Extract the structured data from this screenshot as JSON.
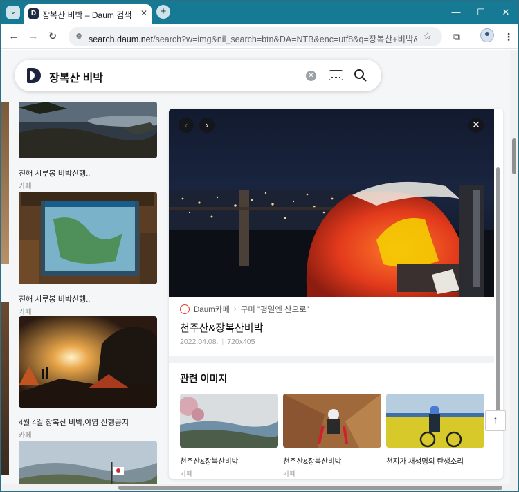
{
  "browser": {
    "tab_title": "장복산 비박 – Daum 검색",
    "tab_favicon": "D",
    "url_host": "search.daum.net",
    "url_path": "/search?w=img&nil_search=btn&DA=NTB&enc=utf8&q=장복산+비박&vi..."
  },
  "search": {
    "query": "장복산 비박"
  },
  "results": [
    {
      "caption": "진해 시루봉 비박산행..",
      "source": "카페"
    },
    {
      "caption": "진해 시루봉 비박산행..",
      "source": "카페"
    },
    {
      "caption": "4월 4일 장복산 비박,야영 산행공지",
      "source": "카페"
    }
  ],
  "detail": {
    "source_site": "Daum카페",
    "source_board": "구미 \"평일엔 산으로\"",
    "title": "천주산&장복산비박",
    "date": "2022.04.08.",
    "size": "720x405",
    "related_heading": "관련 이미지",
    "related": [
      {
        "caption": "천주산&장복산비박",
        "source": "카페"
      },
      {
        "caption": "천주산&장복산비박",
        "source": "카페"
      },
      {
        "caption": "천지가 새생명의 탄생소리",
        "source": ""
      }
    ]
  },
  "icons": {
    "prev": "‹",
    "next": "›",
    "close": "✕",
    "top": "↑"
  }
}
